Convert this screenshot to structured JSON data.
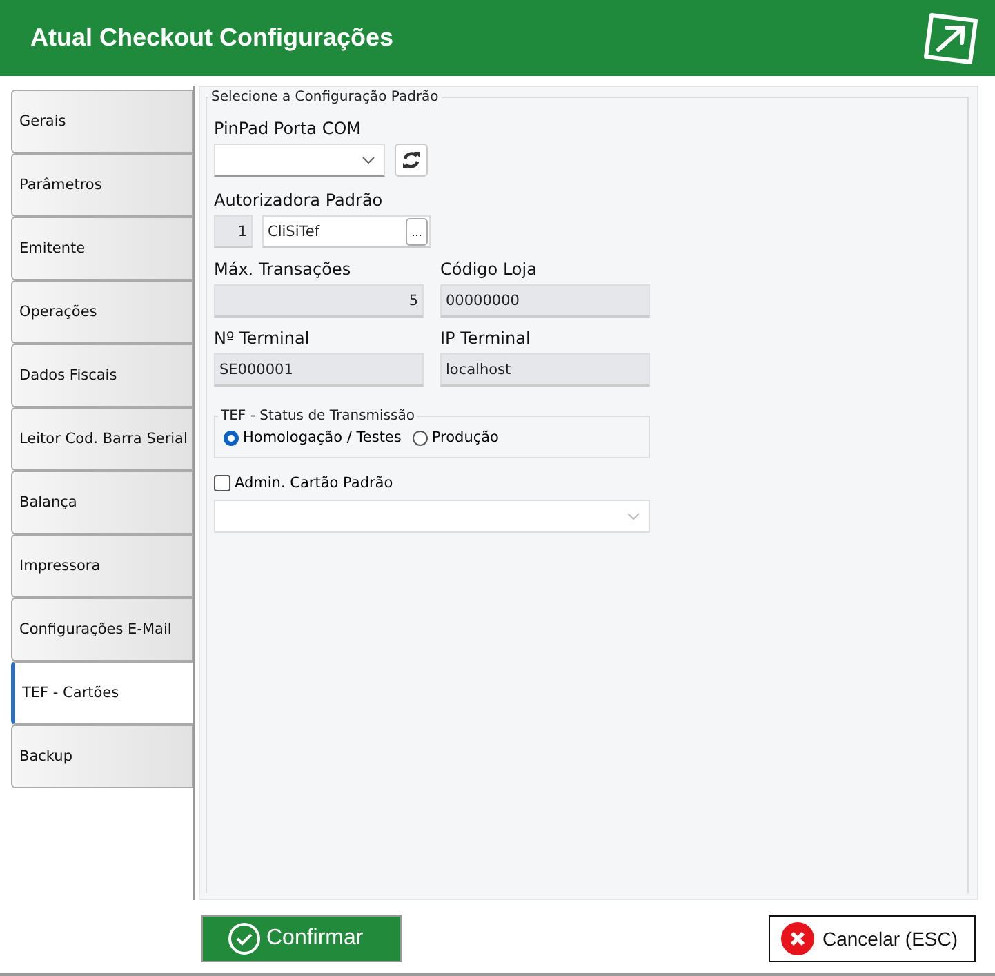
{
  "window": {
    "title": "Atual Checkout Configurações"
  },
  "tabs": [
    {
      "label": "Gerais",
      "selected": false
    },
    {
      "label": "Parâmetros",
      "selected": false
    },
    {
      "label": "Emitente",
      "selected": false
    },
    {
      "label": "Operações",
      "selected": false
    },
    {
      "label": "Dados Fiscais",
      "selected": false
    },
    {
      "label": "Leitor Cod. Barra Serial",
      "selected": false
    },
    {
      "label": "Balança",
      "selected": false
    },
    {
      "label": "Impressora",
      "selected": false
    },
    {
      "label": "Configurações E-Mail",
      "selected": false
    },
    {
      "label": "TEF - Cartões",
      "selected": true
    },
    {
      "label": "Backup",
      "selected": false
    }
  ],
  "group": {
    "legend": "Selecione  a Configuração Padrão",
    "pinpad": {
      "label": "PinPad Porta COM"
    },
    "autorizadora": {
      "label": "Autorizadora Padrão",
      "code": "1",
      "name": "CliSiTef",
      "lookup": "..."
    },
    "max_transacoes": {
      "label": "Máx. Transações",
      "value": "5"
    },
    "codigo_loja": {
      "label": "Código Loja",
      "value": "00000000"
    },
    "terminal": {
      "label": "Nº Terminal",
      "value": "SE000001"
    },
    "ip_terminal": {
      "label": "IP Terminal",
      "value": "localhost"
    },
    "status": {
      "legend": "TEF - Status de Transmissão",
      "options": [
        {
          "label": "Homologação / Testes",
          "selected": true
        },
        {
          "label": "Produção",
          "selected": false
        }
      ]
    },
    "admin": {
      "label": "Admin. Cartão Padrão",
      "checked": false
    }
  },
  "buttons": {
    "confirm": "Confirmar",
    "cancel": "Cancelar (ESC)"
  }
}
